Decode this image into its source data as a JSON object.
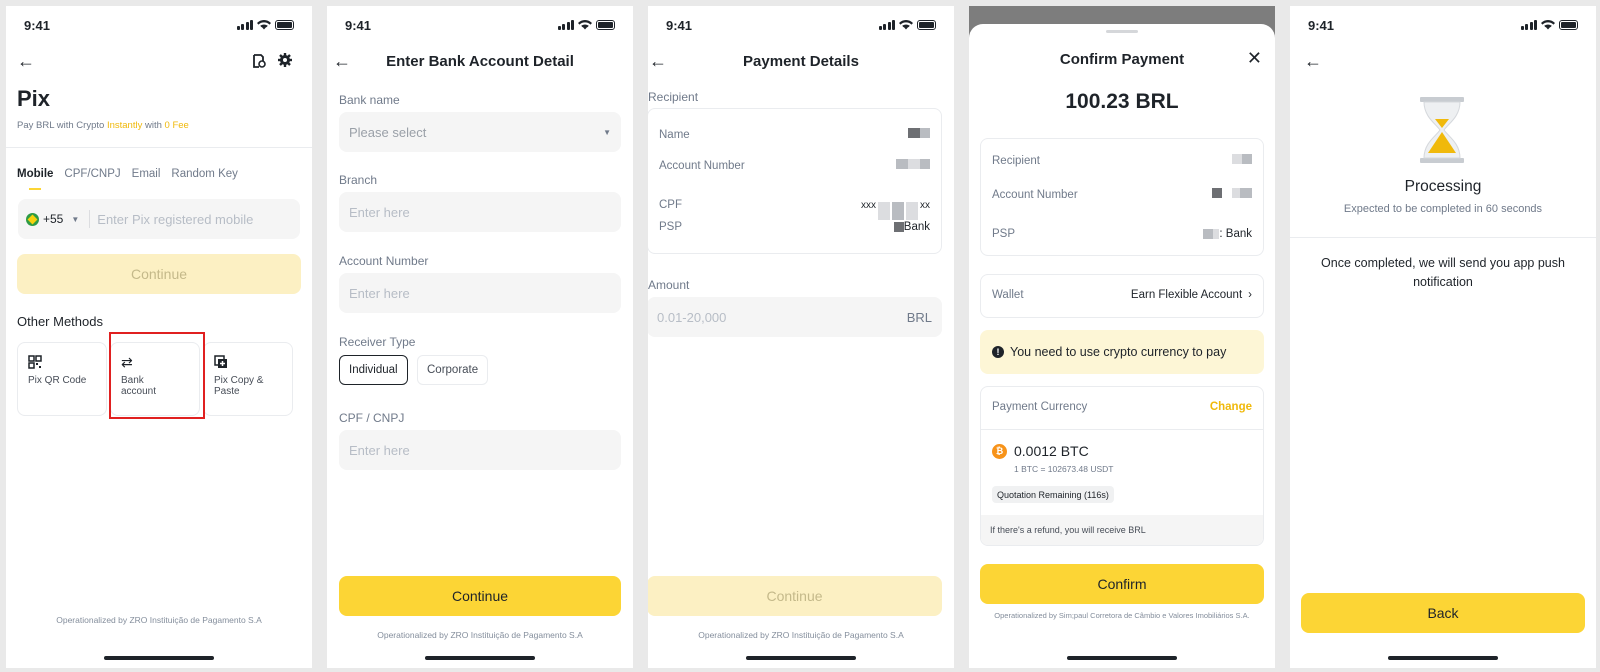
{
  "status_time": "9:41",
  "s1": {
    "title": "Pix",
    "subtitle_pre": "Pay BRL with Crypto ",
    "subtitle_instantly": "Instantly",
    "subtitle_mid": " with ",
    "subtitle_fee": "0 Fee",
    "tabs": [
      "Mobile",
      "CPF/CNPJ",
      "Email",
      "Random Key"
    ],
    "country_code": "+55",
    "mobile_placeholder": "Enter Pix registered mobile",
    "continue_label": "Continue",
    "other_methods_title": "Other Methods",
    "methods": [
      "Pix QR Code",
      "Bank account",
      "Pix Copy & Paste"
    ],
    "footer": "Operationalized by ZRO Instituição de Pagamento S.A"
  },
  "s2": {
    "title": "Enter Bank Account Detail",
    "bank_name_label": "Bank name",
    "bank_name_placeholder": "Please select",
    "branch_label": "Branch",
    "branch_placeholder": "Enter here",
    "account_label": "Account Number",
    "account_placeholder": "Enter here",
    "receiver_label": "Receiver Type",
    "receiver_options": [
      "Individual",
      "Corporate"
    ],
    "cpf_label": "CPF / CNPJ",
    "cpf_placeholder": "Enter here",
    "continue_label": "Continue",
    "footer": "Operationalized by ZRO Instituição de Pagamento S.A"
  },
  "s3": {
    "title": "Payment Details",
    "recipient_label": "Recipient",
    "name_label": "Name",
    "account_label": "Account Number",
    "cpf_label": "CPF",
    "cpf_prefix": "xxx",
    "cpf_suffix": "xx",
    "psp_label": "PSP",
    "psp_value": "Bank",
    "amount_label": "Amount",
    "amount_placeholder": "0.01-20,000",
    "amount_currency": "BRL",
    "continue_label": "Continue",
    "footer": "Operationalized by ZRO Instituição de Pagamento S.A"
  },
  "s4": {
    "title": "Confirm Payment",
    "amount": "100.23 BRL",
    "recipient_label": "Recipient",
    "account_label": "Account Number",
    "psp_label": "PSP",
    "psp_value": ": Bank",
    "wallet_label": "Wallet",
    "wallet_value": "Earn Flexible Account",
    "warning": "You need to use crypto currency to pay",
    "payment_currency_label": "Payment Currency",
    "change_label": "Change",
    "crypto_amount": "0.0012 BTC",
    "rate": "1 BTC = 102673.48 USDT",
    "quotation": "Quotation Remaining (116s)",
    "refund_note": "If there's a refund, you will receive BRL",
    "confirm_label": "Confirm",
    "footer": "Operationalized by Sim;paul Corretora de Câmbio e Valores Imobiliários S.A."
  },
  "s5": {
    "status_title": "Processing",
    "status_sub": "Expected to be completed in 60 seconds",
    "message": "Once completed, we will send you app push notification",
    "back_label": "Back"
  },
  "colors": {
    "accent": "#fcd535",
    "highlight_box": "#e02020",
    "brand_text": "#f0b90b"
  }
}
